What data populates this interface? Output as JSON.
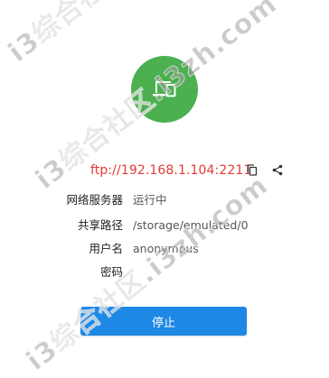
{
  "server": {
    "status_icon": "devices-icon",
    "status_color": "#4caf50",
    "url": "ftp://192.168.1.104:2211",
    "url_color": "#e53935"
  },
  "actions": {
    "copy_icon": "copy-icon",
    "share_icon": "share-icon"
  },
  "info": {
    "network_service_label": "网络服务器",
    "network_service_value": "运行中",
    "shared_path_label": "共享路径",
    "shared_path_value": "/storage/emulated/0",
    "username_label": "用户名",
    "username_value": "anonymous",
    "password_label": "密码",
    "password_value": ""
  },
  "stop_button": {
    "label": "停止",
    "color": "#1e88e5"
  },
  "watermark": {
    "text": "i3综合社区.i3zh.com"
  }
}
